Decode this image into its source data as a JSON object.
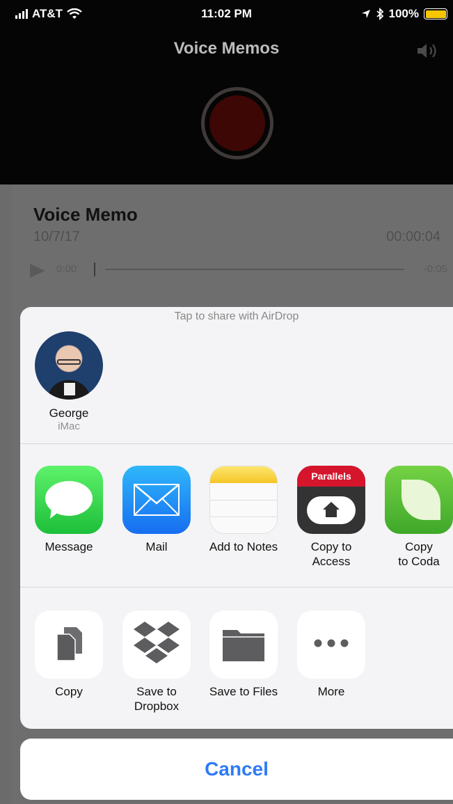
{
  "status_bar": {
    "carrier": "AT&T",
    "time": "11:02 PM",
    "battery_percent": "100%",
    "battery_color": "#f7c600"
  },
  "app": {
    "title": "Voice Memos"
  },
  "memo": {
    "title": "Voice Memo",
    "date": "10/7/17",
    "duration": "00:00:04",
    "elapsed": "0:00",
    "remaining": "-0:05"
  },
  "share_sheet": {
    "airdrop_hint": "Tap to share with AirDrop",
    "contact": {
      "name": "George",
      "device": "iMac"
    },
    "apps": [
      {
        "label": "Message",
        "icon": "messages-icon"
      },
      {
        "label": "Mail",
        "icon": "mail-icon"
      },
      {
        "label": "Add to Notes",
        "icon": "notes-icon"
      },
      {
        "label": "Copy to\nAccess",
        "icon": "parallels-access-icon",
        "badge": "Parallels"
      },
      {
        "label": "Copy\nto Coda",
        "icon": "coda-icon"
      }
    ],
    "actions": [
      {
        "label": "Copy",
        "icon": "copy-icon"
      },
      {
        "label": "Save to\nDropbox",
        "icon": "dropbox-icon"
      },
      {
        "label": "Save to Files",
        "icon": "folder-icon"
      },
      {
        "label": "More",
        "icon": "more-icon"
      }
    ],
    "cancel_label": "Cancel",
    "accent_color": "#2f7bf6"
  }
}
